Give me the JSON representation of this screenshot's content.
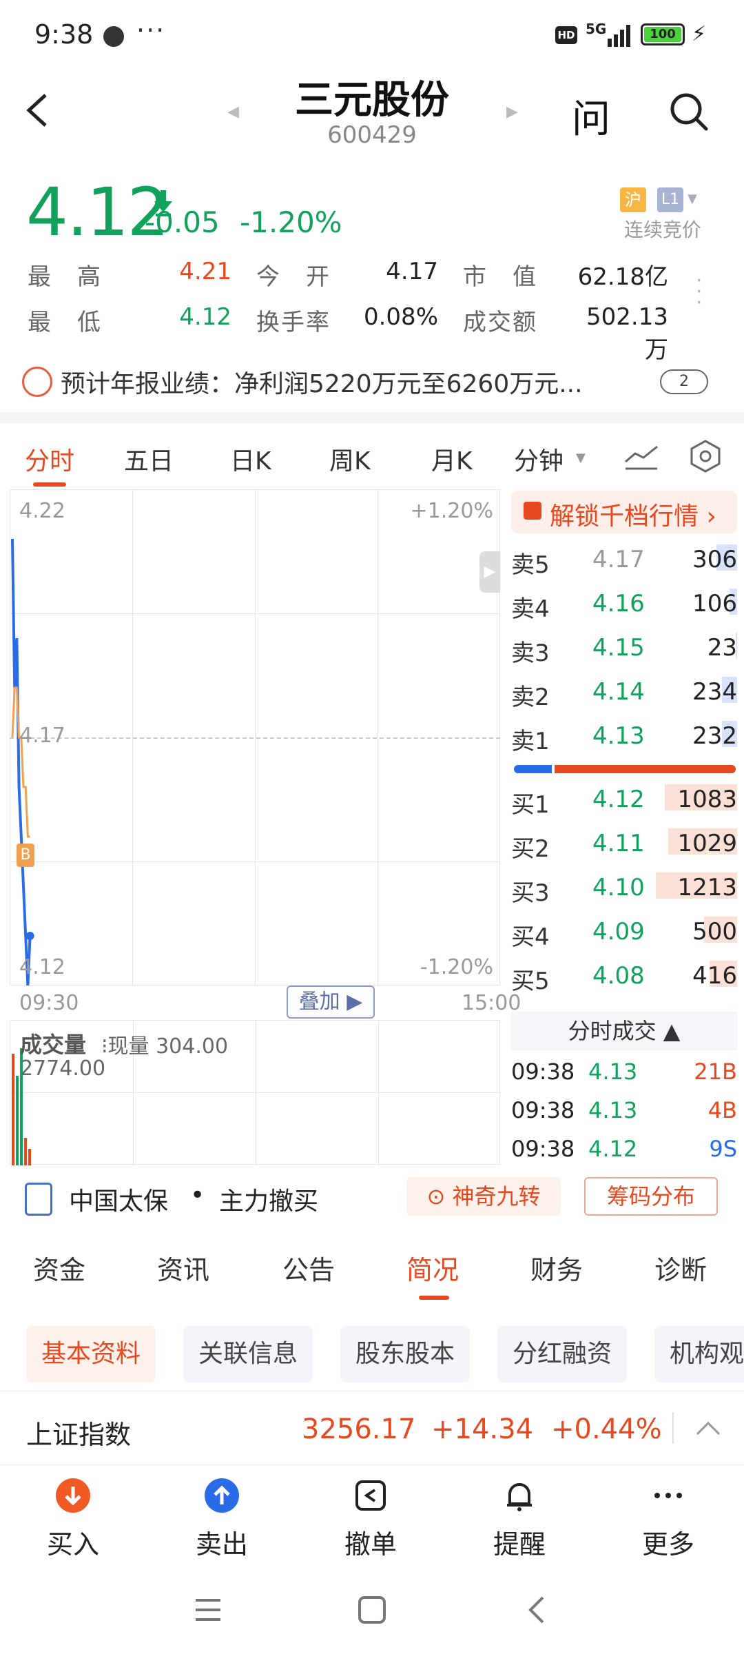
{
  "status_bar": {
    "time": "9:38",
    "more": "···",
    "hd": "HD",
    "network": "5G",
    "battery": "100"
  },
  "header": {
    "stock_name": "三元股份",
    "stock_code": "600429",
    "ask_label": "问"
  },
  "quote": {
    "price": "4.12",
    "change": "-0.05",
    "change_pct": "-1.20%",
    "exchange_tag": "沪",
    "level_tag": "L1",
    "trading_status": "连续竞价",
    "stats": [
      {
        "label": "最　高",
        "value": "4.21",
        "color": "red"
      },
      {
        "label": "今　开",
        "value": "4.17",
        "color": "black"
      },
      {
        "label": "市　值",
        "value": "62.18亿",
        "color": "black"
      },
      {
        "label": "最　低",
        "value": "4.12",
        "color": "green"
      },
      {
        "label": "换手率",
        "value": "0.08%",
        "color": "black"
      },
      {
        "label": "成交额",
        "value": "502.13万",
        "color": "black"
      }
    ]
  },
  "notice": {
    "text": "预计年报业绩：净利润5220万元至6260万元...",
    "badge": "2"
  },
  "chart_tabs": [
    "分时",
    "五日",
    "日K",
    "周K",
    "月K",
    "分钟"
  ],
  "chart": {
    "y_top": "4.22",
    "y_mid": "4.17",
    "y_bot": "4.12",
    "pct_top": "+1.20%",
    "pct_bot": "-1.20%",
    "t_start": "09:30",
    "t_end": "15:00",
    "overlay_btn": "叠加",
    "b_marker": "B",
    "vol_title": "成交量",
    "vol_current": "现量 304.00",
    "vol_max": "2774.00"
  },
  "chart_data": {
    "type": "line",
    "title": "",
    "series": [
      {
        "name": "",
        "x": [
          "09:30",
          "09:31",
          "09:32",
          "09:33",
          "09:34",
          "09:35",
          "09:36",
          "09:37",
          "09:38"
        ],
        "values": [
          4.21,
          4.18,
          4.19,
          4.16,
          4.15,
          4.14,
          4.13,
          4.12,
          4.13
        ]
      },
      {
        "name": "",
        "x": [
          "09:30",
          "09:31",
          "09:32",
          "09:33",
          "09:34",
          "09:35",
          "09:36",
          "09:37",
          "09:38"
        ],
        "values": [
          4.17,
          4.18,
          4.18,
          4.17,
          4.17,
          4.16,
          4.16,
          4.15,
          4.15
        ]
      }
    ],
    "ylim": [
      4.12,
      4.22
    ],
    "xlim": [
      "09:30",
      "15:00"
    ]
  },
  "unlock_label": "解锁千档行情",
  "order_book": {
    "asks": [
      {
        "label": "卖5",
        "price": "4.17",
        "volume": "306",
        "fill": 0.25
      },
      {
        "label": "卖4",
        "price": "4.16",
        "volume": "106",
        "fill": 0.09
      },
      {
        "label": "卖3",
        "price": "4.15",
        "volume": "23",
        "fill": 0.02
      },
      {
        "label": "卖2",
        "price": "4.14",
        "volume": "234",
        "fill": 0.19
      },
      {
        "label": "卖1",
        "price": "4.13",
        "volume": "232",
        "fill": 0.19
      }
    ],
    "bids": [
      {
        "label": "买1",
        "price": "4.12",
        "volume": "1083",
        "fill": 0.89
      },
      {
        "label": "买2",
        "price": "4.11",
        "volume": "1029",
        "fill": 0.85
      },
      {
        "label": "买3",
        "price": "4.10",
        "volume": "1213",
        "fill": 1.0
      },
      {
        "label": "买4",
        "price": "4.09",
        "volume": "500",
        "fill": 0.41
      },
      {
        "label": "买5",
        "price": "4.08",
        "volume": "416",
        "fill": 0.34
      }
    ],
    "buy_ratio": 0.17
  },
  "trades": {
    "title": "分时成交",
    "rows": [
      {
        "time": "09:38",
        "price": "4.13",
        "volume": "21B",
        "side": "buy"
      },
      {
        "time": "09:38",
        "price": "4.13",
        "volume": "4B",
        "side": "buy"
      },
      {
        "time": "09:38",
        "price": "4.12",
        "volume": "9S",
        "side": "sell"
      }
    ]
  },
  "tools": {
    "related": "中国太保",
    "bullet": "•",
    "news": "主力撤买",
    "btn1": "神奇九转",
    "btn2": "筹码分布"
  },
  "info_tabs": [
    "资金",
    "资讯",
    "公告",
    "简况",
    "财务",
    "诊断"
  ],
  "chips": [
    "基本资料",
    "关联信息",
    "股东股本",
    "分红融资",
    "机构观"
  ],
  "index_bar": {
    "name": "上证指数",
    "value": "3256.17",
    "change": "+14.34",
    "pct": "+0.44%"
  },
  "bottom_nav": [
    "买入",
    "卖出",
    "撤单",
    "提醒",
    "更多"
  ]
}
